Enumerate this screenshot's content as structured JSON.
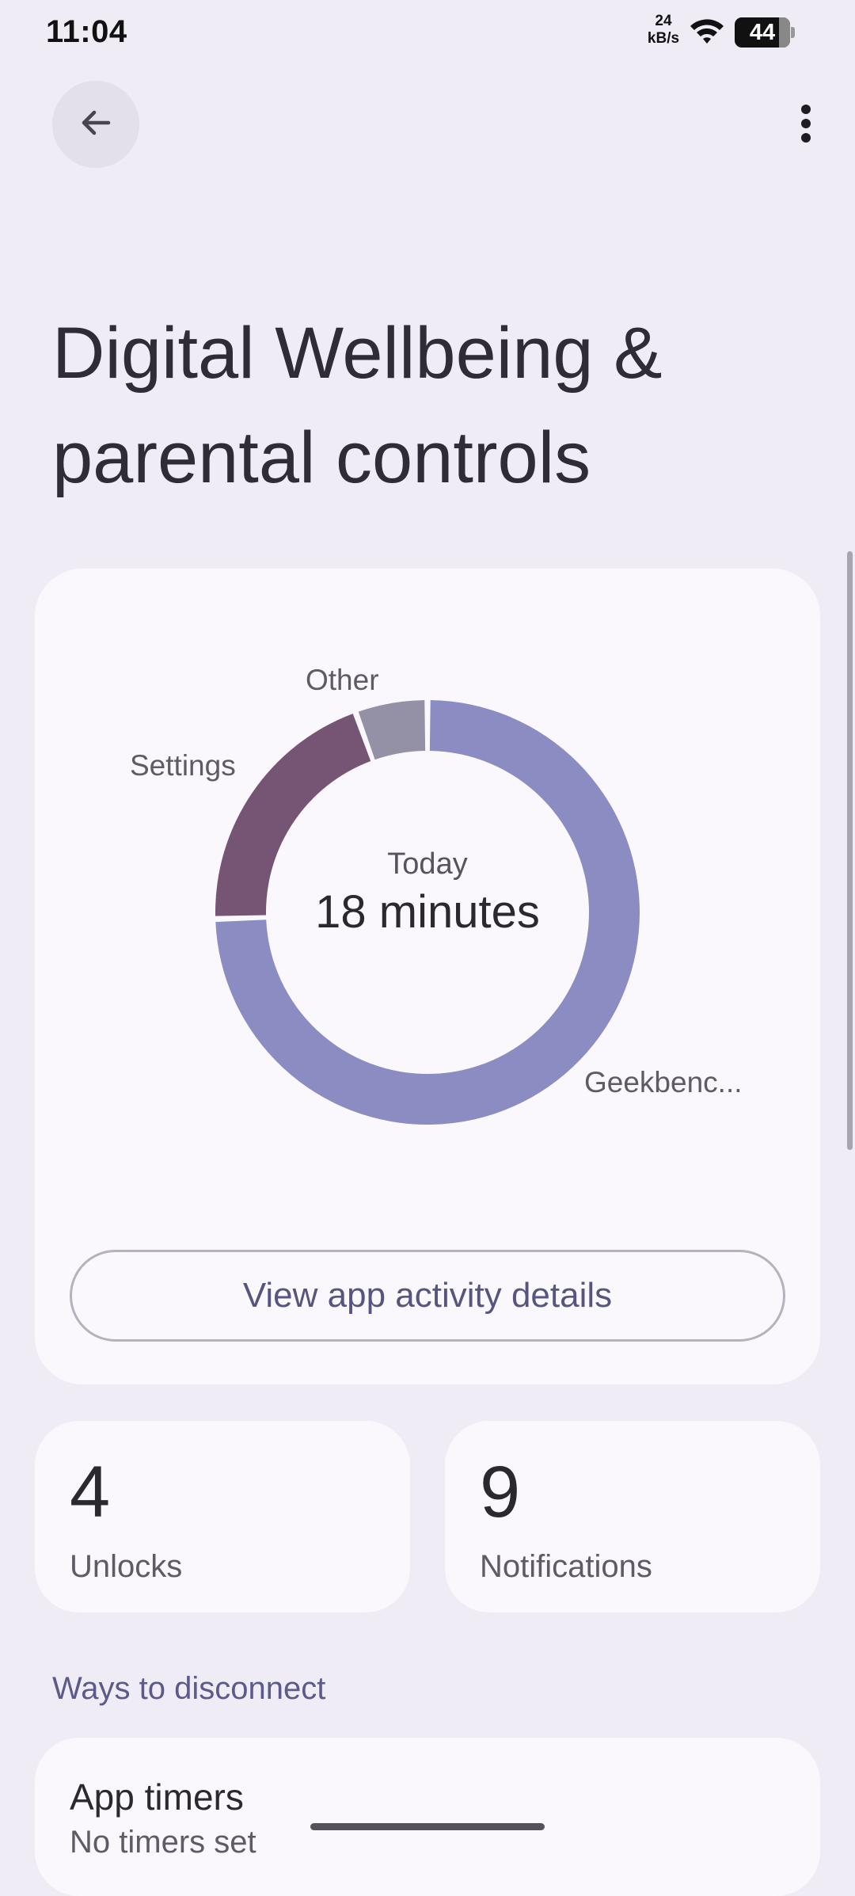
{
  "status_bar": {
    "time": "11:04",
    "net_speed_value": "24",
    "net_speed_unit": "kB/s",
    "battery": "44",
    "battery_level_percent": 44
  },
  "header": {
    "title": "Digital Wellbeing & parental controls"
  },
  "usage_card": {
    "caption": "Today",
    "total": "18 minutes",
    "segments": [
      {
        "label": "Geekbenc...",
        "share": 0.745,
        "color": "#8b8cc2"
      },
      {
        "label": "Settings",
        "share": 0.2,
        "color": "#765574"
      },
      {
        "label": "Other",
        "share": 0.055,
        "color": "#9491a6"
      }
    ],
    "button_label": "View app activity details"
  },
  "stats": {
    "unlocks_value": "4",
    "unlocks_label": "Unlocks",
    "notifications_value": "9",
    "notifications_label": "Notifications"
  },
  "disconnect": {
    "section_title": "Ways to disconnect",
    "app_timers_title": "App timers",
    "app_timers_sub": "No timers set"
  }
}
